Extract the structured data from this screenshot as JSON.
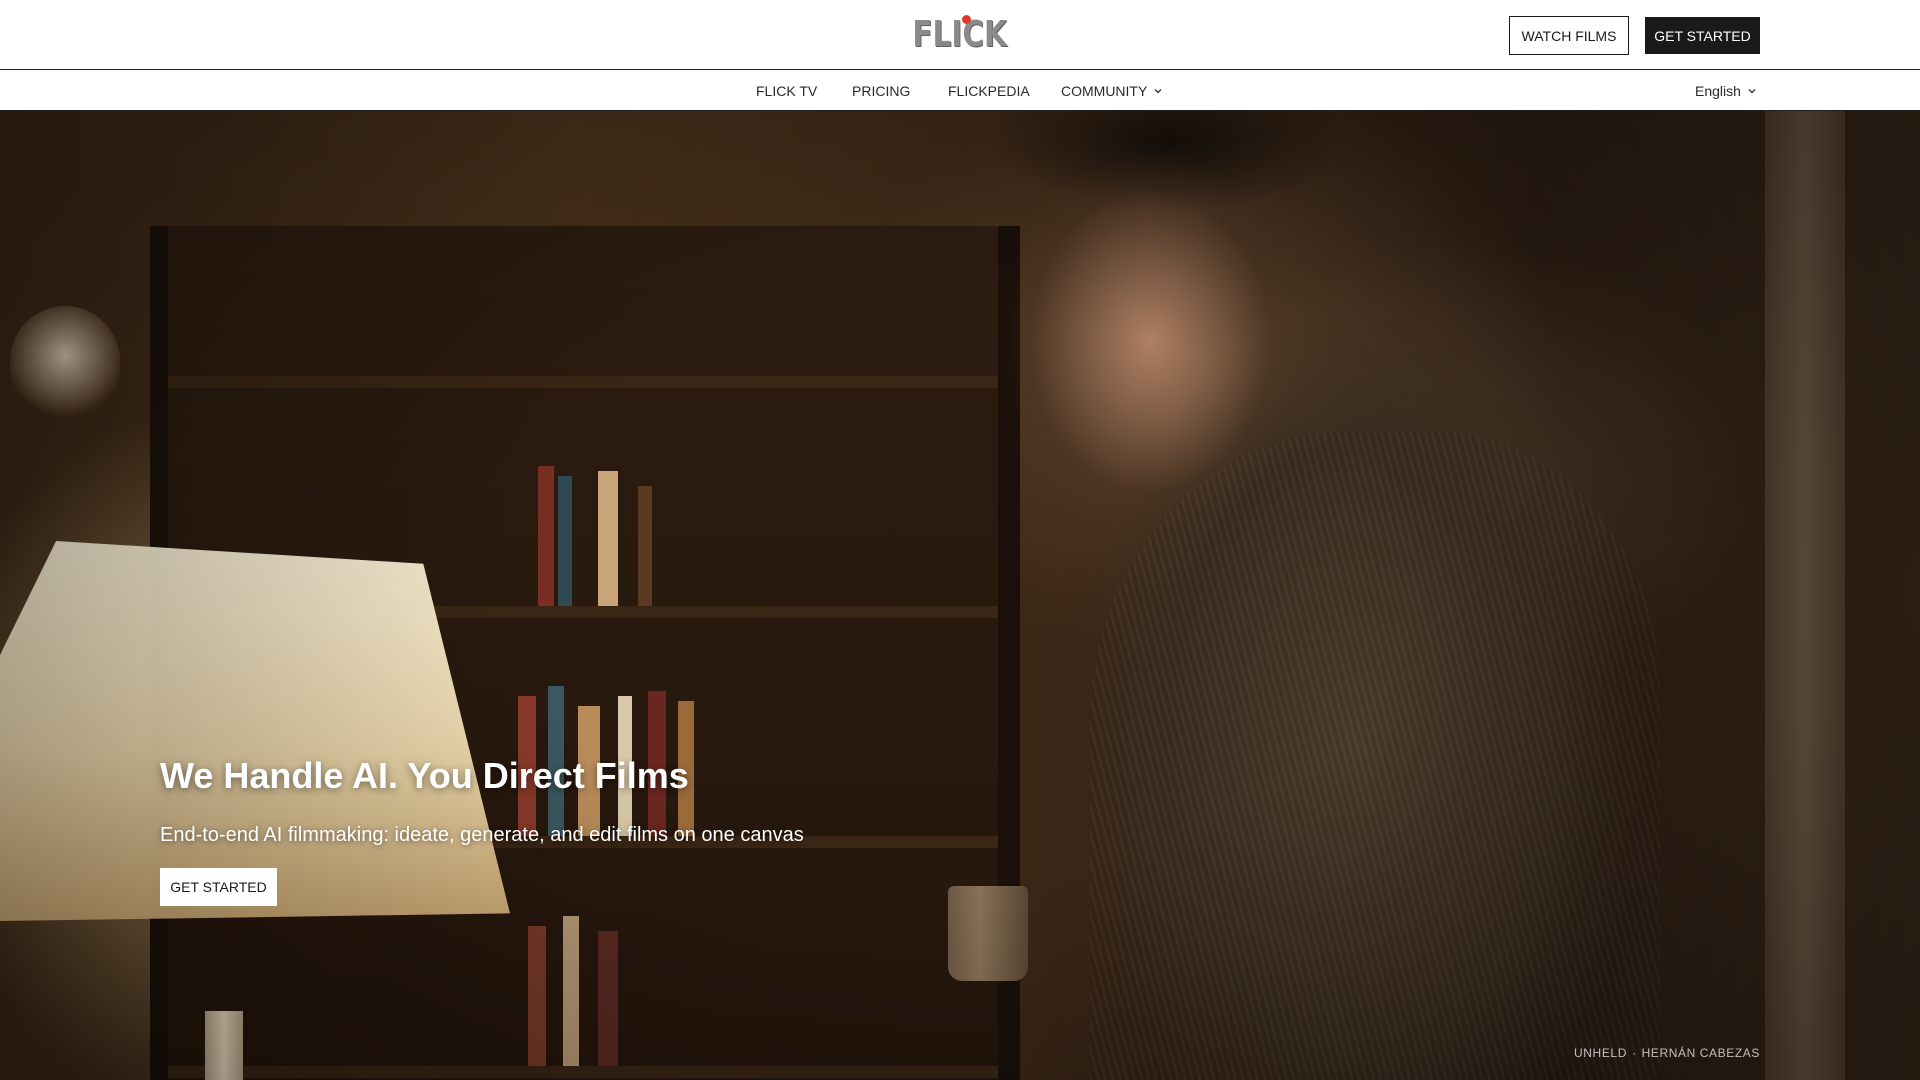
{
  "header": {
    "logo_text": "FLICK",
    "watch_films_label": "WATCH FILMS",
    "get_started_label": "GET STARTED"
  },
  "nav": {
    "items": [
      {
        "label": "FLICK TV"
      },
      {
        "label": "PRICING"
      },
      {
        "label": "FLICKPEDIA"
      },
      {
        "label": "COMMUNITY"
      }
    ],
    "language": "English"
  },
  "hero": {
    "title": "We Handle AI. You Direct Films",
    "subtitle": "End-to-end AI filmmaking: ideate, generate, and edit films on one canvas",
    "cta_label": "GET STARTED",
    "credit_title": "UNHELD",
    "credit_separator": "·",
    "credit_author": "HERNÁN CABEZAS"
  },
  "colors": {
    "logo_dot": "#e03b2a",
    "dark_button": "#1a1a1a",
    "border": "#1e1e1e"
  },
  "icons": {
    "community_dropdown": "chevron-down-icon",
    "language_dropdown": "chevron-down-icon"
  }
}
